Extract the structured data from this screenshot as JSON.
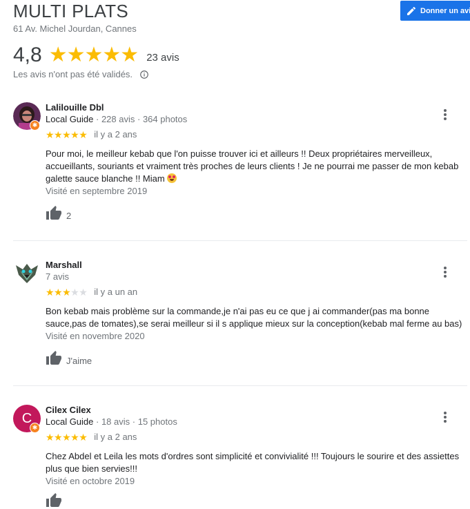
{
  "place": {
    "name": "MULTI PLATS",
    "address": "61 Av. Michel Jourdan, Cannes",
    "rating": "4,8",
    "stars": "★★★★★",
    "review_count": "23 avis",
    "unverified_note": "Les avis n'ont pas été validés."
  },
  "write_review_label": "Donner un avis",
  "colors": {
    "accent": "#1a73e8",
    "star": "#fbbc04",
    "star_empty": "#dadce0",
    "guide_badge": "#f6821f"
  },
  "reviews": [
    {
      "name": "Lalilouille Dbl",
      "guide": "Local Guide",
      "sep1": " · ",
      "avis": "228 avis",
      "sep2": " · ",
      "photos": "364 photos",
      "stars_filled": "★★★★★",
      "stars_empty": "",
      "rating": 5,
      "date": "il y a 2 ans",
      "text": "Pour moi, le meilleur kebab que l'on puisse trouver ici et ailleurs !! Deux propriétaires merveilleux, accueillants, souriants et vraiment très proches de leurs clients ! Je ne pourrai me passer de mon kebab galette sauce blanche !! Miam",
      "emoji": "heart-eyes-emoji",
      "visited": "Visité en septembre 2019",
      "likes": "2"
    },
    {
      "name": "Marshall",
      "avis": "7 avis",
      "stars_filled": "★★★",
      "stars_empty": "★★",
      "rating": 3,
      "date": "il y a un an",
      "text": "Bon kebab mais problème sur la commande,je n'ai pas eu ce que j ai commander(pas ma bonne sauce,pas de tomates),se serai meilleur si il s applique mieux sur la conception(kebab mal ferme au bas)",
      "visited": "Visité en novembre 2020",
      "likes": "J'aime"
    },
    {
      "name": "Cilex Cilex",
      "initial": "C",
      "guide": "Local Guide",
      "sep1": " · ",
      "avis": "18 avis",
      "sep2": " · ",
      "photos": "15 photos",
      "stars_filled": "★★★★★",
      "stars_empty": "",
      "rating": 5,
      "date": "il y a 2 ans",
      "text": "Chez Abdel et Leila les mots d'ordres sont simplicité et convivialité !!! Toujours le sourire et des assiettes plus que bien servies!!!",
      "visited": "Visité en octobre 2019"
    }
  ],
  "icons": [
    "pencil-icon",
    "info-icon",
    "more-vert-icon",
    "thumb-up-icon",
    "local-guide-badge-icon"
  ]
}
